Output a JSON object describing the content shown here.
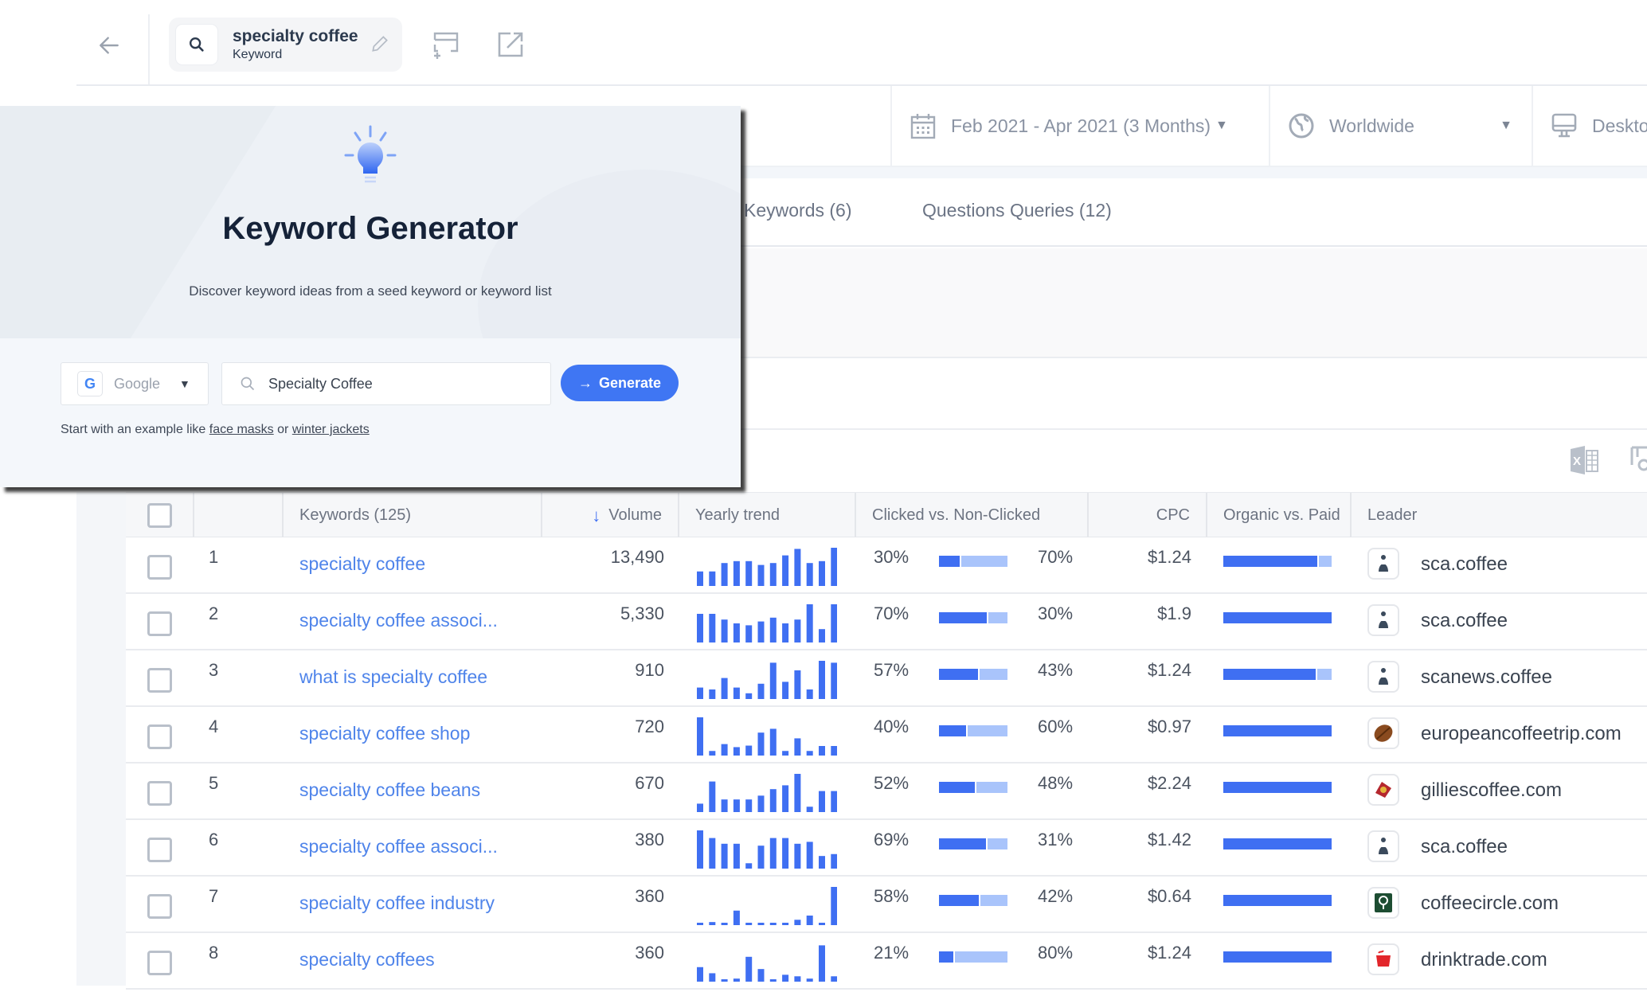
{
  "topbar": {
    "search_title": "specialty coffee",
    "search_type": "Keyword",
    "icons": [
      "back-arrow-icon",
      "search-icon",
      "pencil-icon",
      "add-to-compare-icon",
      "external-link-icon"
    ]
  },
  "filters": {
    "date_range": "Feb 2021 - Apr 2021 (3 Months)",
    "country": "Worldwide",
    "device": "Deskto"
  },
  "tabs": [
    {
      "label": "Keywords (6)"
    },
    {
      "label": "Questions Queries (12)"
    }
  ],
  "table": {
    "columns": {
      "keywords": "Keywords (125)",
      "volume": "Volume",
      "trend": "Yearly trend",
      "clicked": "Clicked vs. Non-Clicked",
      "cpc": "CPC",
      "organic": "Organic vs. Paid",
      "leader": "Leader"
    },
    "sort_column": "Volume",
    "sort_direction": "desc",
    "colors": {
      "primary": "#3f6ff2",
      "secondary": "#a9c4fb"
    },
    "rows": [
      {
        "num": "1",
        "keyword": "specialty coffee",
        "volume": "13,490",
        "trend": [
          0.38,
          0.38,
          0.6,
          0.65,
          0.65,
          0.55,
          0.6,
          0.8,
          0.97,
          0.6,
          0.65,
          1.0
        ],
        "clicked": 30,
        "nonclicked": 70,
        "clicked_label": "30%",
        "nonclicked_label": "70%",
        "cpc": "$1.24",
        "organic": 87,
        "leader": "sca.coffee",
        "favicon": "sca"
      },
      {
        "num": "2",
        "keyword": "specialty coffee associ...",
        "volume": "5,330",
        "trend": [
          0.75,
          0.75,
          0.6,
          0.5,
          0.45,
          0.55,
          0.65,
          0.5,
          0.6,
          1.0,
          0.35,
          1.0
        ],
        "clicked": 70,
        "nonclicked": 30,
        "clicked_label": "70%",
        "nonclicked_label": "30%",
        "cpc": "$1.9",
        "organic": 100,
        "leader": "sca.coffee",
        "favicon": "sca"
      },
      {
        "num": "3",
        "keyword": "what is specialty coffee",
        "volume": "910",
        "trend": [
          0.3,
          0.25,
          0.55,
          0.3,
          0.15,
          0.4,
          0.95,
          0.45,
          0.75,
          0.25,
          1.0,
          0.95
        ],
        "clicked": 57,
        "nonclicked": 43,
        "clicked_label": "57%",
        "nonclicked_label": "43%",
        "cpc": "$1.24",
        "organic": 85,
        "leader": "scanews.coffee",
        "favicon": "sca"
      },
      {
        "num": "4",
        "keyword": "specialty coffee shop",
        "volume": "720",
        "trend": [
          1.0,
          0.12,
          0.3,
          0.22,
          0.26,
          0.6,
          0.7,
          0.12,
          0.45,
          0.12,
          0.25,
          0.25
        ],
        "clicked": 40,
        "nonclicked": 60,
        "clicked_label": "40%",
        "nonclicked_label": "60%",
        "cpc": "$0.97",
        "organic": 100,
        "leader": "europeancoffeetrip.com",
        "favicon": "bean"
      },
      {
        "num": "5",
        "keyword": "specialty coffee beans",
        "volume": "670",
        "trend": [
          0.22,
          0.8,
          0.33,
          0.33,
          0.33,
          0.43,
          0.6,
          0.7,
          1.0,
          0.14,
          0.55,
          0.55
        ],
        "clicked": 52,
        "nonclicked": 48,
        "clicked_label": "52%",
        "nonclicked_label": "48%",
        "cpc": "$2.24",
        "organic": 100,
        "leader": "gilliescoffee.com",
        "favicon": "gillies"
      },
      {
        "num": "6",
        "keyword": "specialty coffee associ...",
        "volume": "380",
        "trend": [
          1.0,
          0.8,
          0.65,
          0.65,
          0.14,
          0.6,
          0.8,
          0.8,
          0.65,
          0.7,
          0.33,
          0.38
        ],
        "clicked": 69,
        "nonclicked": 31,
        "clicked_label": "69%",
        "nonclicked_label": "31%",
        "cpc": "$1.42",
        "organic": 100,
        "leader": "sca.coffee",
        "favicon": "sca"
      },
      {
        "num": "7",
        "keyword": "specialty coffee industry",
        "volume": "360",
        "trend": [
          0.05,
          0.08,
          0.05,
          0.38,
          0.05,
          0.05,
          0.05,
          0.05,
          0.14,
          0.25,
          0.05,
          1.0
        ],
        "clicked": 58,
        "nonclicked": 42,
        "clicked_label": "58%",
        "nonclicked_label": "42%",
        "cpc": "$0.64",
        "organic": 100,
        "leader": "coffeecircle.com",
        "favicon": "circle"
      },
      {
        "num": "8",
        "keyword": "specialty coffees",
        "volume": "360",
        "trend": [
          0.38,
          0.22,
          0.04,
          0.08,
          0.65,
          0.33,
          0.04,
          0.18,
          0.14,
          0.08,
          0.95,
          0.14
        ],
        "clicked": 21,
        "nonclicked": 80,
        "clicked_label": "21%",
        "nonclicked_label": "80%",
        "cpc": "$1.24",
        "organic": 100,
        "leader": "drinktrade.com",
        "favicon": "drinktrade"
      }
    ]
  },
  "modal": {
    "title": "Keyword Generator",
    "subtitle": "Discover keyword ideas from a seed keyword or keyword list",
    "engine": "Google",
    "input_value": "Specialty Coffee",
    "generate_label": "Generate",
    "hint_prefix": "Start with an example like",
    "hint_link1": "face masks",
    "hint_or": "or",
    "hint_link2": "winter jackets",
    "accent": "#3f76f3"
  }
}
